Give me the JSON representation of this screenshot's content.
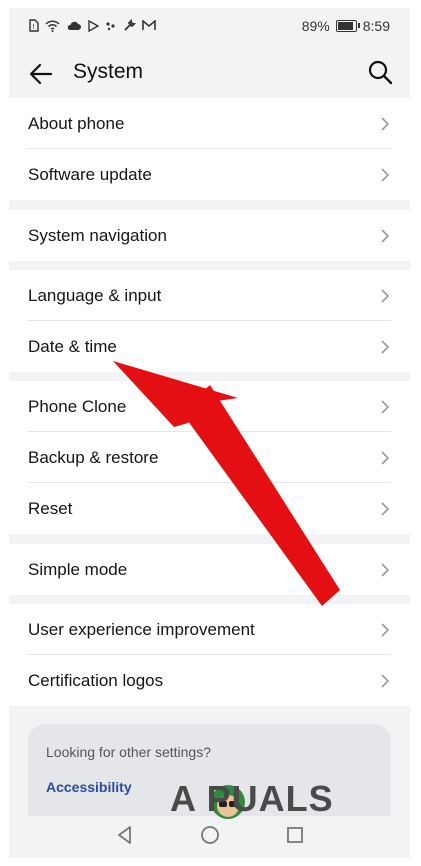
{
  "status_bar": {
    "battery": "89%",
    "time": "8:59",
    "battery_level": 0.89
  },
  "header": {
    "title": "System"
  },
  "groups": [
    {
      "rows": [
        {
          "label": "About phone"
        },
        {
          "label": "Software update"
        }
      ]
    },
    {
      "rows": [
        {
          "label": "System navigation"
        }
      ]
    },
    {
      "rows": [
        {
          "label": "Language & input"
        },
        {
          "label": "Date & time"
        }
      ]
    },
    {
      "rows": [
        {
          "label": "Phone Clone"
        },
        {
          "label": "Backup & restore"
        },
        {
          "label": "Reset"
        }
      ]
    },
    {
      "rows": [
        {
          "label": "Simple mode"
        }
      ]
    },
    {
      "rows": [
        {
          "label": "User experience improvement"
        },
        {
          "label": "Certification logos"
        }
      ]
    }
  ],
  "suggestion": {
    "question": "Looking for other settings?",
    "link": "Accessibility"
  },
  "watermark": {
    "text": "A  PUALS"
  },
  "colors": {
    "background": "#f1f3f5",
    "card": "#ffffff",
    "link": "#2b4aa3",
    "arrow": "#e30f12"
  }
}
